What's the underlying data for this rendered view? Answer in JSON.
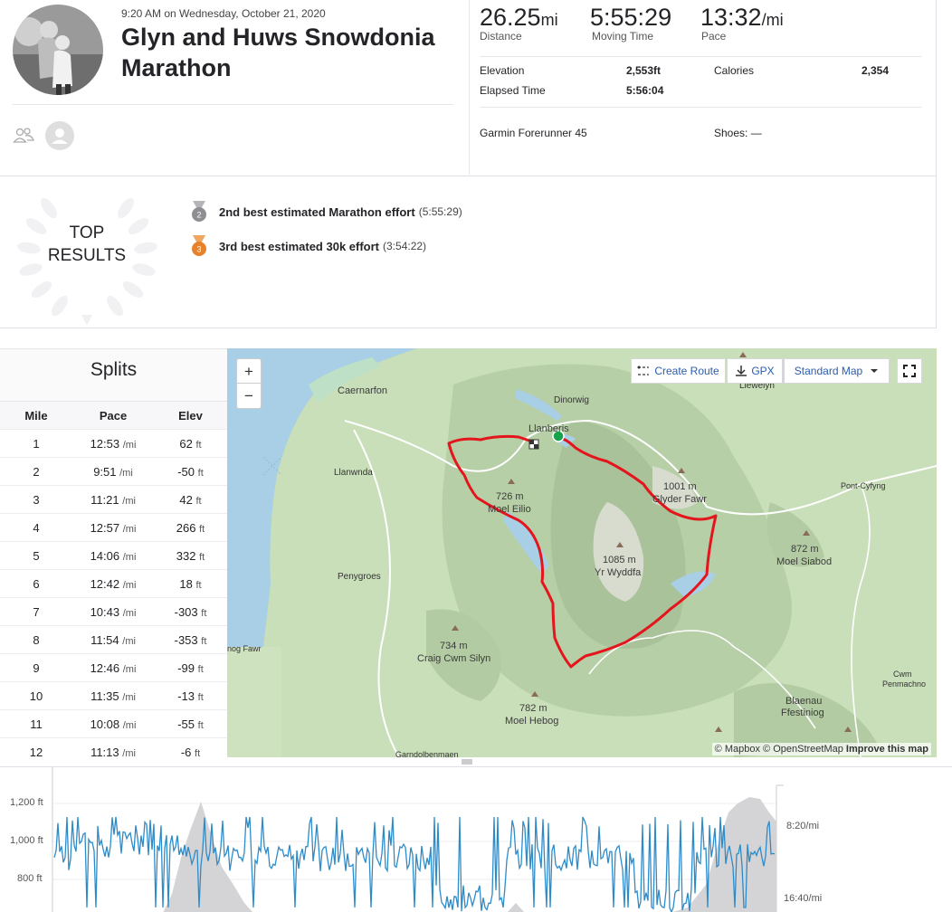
{
  "activity": {
    "datetime": "9:20 AM on Wednesday, October 21, 2020",
    "title": "Glyn and Huws Snowdonia Marathon"
  },
  "stats": {
    "distance": {
      "value": "26.25",
      "unit": "mi",
      "label": "Distance"
    },
    "moving_time": {
      "value": "5:55:29",
      "label": "Moving Time"
    },
    "pace": {
      "value": "13:32",
      "unit": "/mi",
      "label": "Pace"
    },
    "elevation_label": "Elevation",
    "elevation_value": "2,553ft",
    "calories_label": "Calories",
    "calories_value": "2,354",
    "elapsed_label": "Elapsed Time",
    "elapsed_value": "5:56:04",
    "device": "Garmin Forerunner 45",
    "shoes_label": "Shoes: —"
  },
  "top_results": {
    "title_line1": "TOP",
    "title_line2": "RESULTS",
    "items": [
      {
        "medal": "2",
        "color": "#8e8e93",
        "text": "2nd best estimated Marathon effort",
        "time": "(5:55:29)"
      },
      {
        "medal": "3",
        "color": "#e7812a",
        "text": "3rd best estimated 30k effort",
        "time": "(3:54:22)"
      }
    ]
  },
  "splits": {
    "title": "Splits",
    "headers": [
      "Mile",
      "Pace",
      "Elev"
    ],
    "pace_unit": "/mi",
    "elev_unit": "ft",
    "rows": [
      {
        "mile": "1",
        "pace": "12:53",
        "elev": "62"
      },
      {
        "mile": "2",
        "pace": "9:51",
        "elev": "-50"
      },
      {
        "mile": "3",
        "pace": "11:21",
        "elev": "42"
      },
      {
        "mile": "4",
        "pace": "12:57",
        "elev": "266"
      },
      {
        "mile": "5",
        "pace": "14:06",
        "elev": "332"
      },
      {
        "mile": "6",
        "pace": "12:42",
        "elev": "18"
      },
      {
        "mile": "7",
        "pace": "10:43",
        "elev": "-303"
      },
      {
        "mile": "8",
        "pace": "11:54",
        "elev": "-353"
      },
      {
        "mile": "9",
        "pace": "12:46",
        "elev": "-99"
      },
      {
        "mile": "10",
        "pace": "11:35",
        "elev": "-13"
      },
      {
        "mile": "11",
        "pace": "10:08",
        "elev": "-55"
      },
      {
        "mile": "12",
        "pace": "11:13",
        "elev": "-6"
      }
    ]
  },
  "map": {
    "zoom_in": "+",
    "zoom_out": "−",
    "create_route": "Create Route",
    "gpx": "GPX",
    "standard_map": "Standard Map",
    "route_color": "#e4151c",
    "start_color": "#16a34a",
    "places": {
      "caernarfon": "Caernarfon",
      "dinorwig": "Dinorwig",
      "llanberis": "Llanberis",
      "llanwnda": "Llanwnda",
      "penygroes": "Penygroes",
      "pont_cyfyng": "Pont-Cyfyng",
      "llewelyn": "Llewelyn",
      "moel_eilio_h": "726 m",
      "moel_eilio": "Moel Eilio",
      "glyder_h": "1001 m",
      "glyder": "Glyder Fawr",
      "yr_wyddfa_h": "1085 m",
      "yr_wyddfa": "Yr Wyddfa",
      "siabod_h": "872 m",
      "siabod": "Moel Siabod",
      "silyn_h": "734 m",
      "silyn": "Craig Cwm Silyn",
      "hebog_h": "782 m",
      "hebog": "Moel Hebog",
      "blaenau1": "Blaenau",
      "blaenau2": "Ffestiniog",
      "cwm1": "Cwm",
      "cwm2": "Penmachno",
      "fawr": "nog Fawr",
      "garndolbenmaen": "Garndolbenmaen"
    },
    "attribution_mapbox": "© Mapbox",
    "attribution_osm": "© OpenStreetMap",
    "attribution_improve": "Improve this map"
  },
  "chart": {
    "left_ticks": [
      "1,200 ft",
      "1,000 ft",
      "800 ft"
    ],
    "right_ticks": [
      "8:20/mi",
      "16:40/mi"
    ]
  }
}
